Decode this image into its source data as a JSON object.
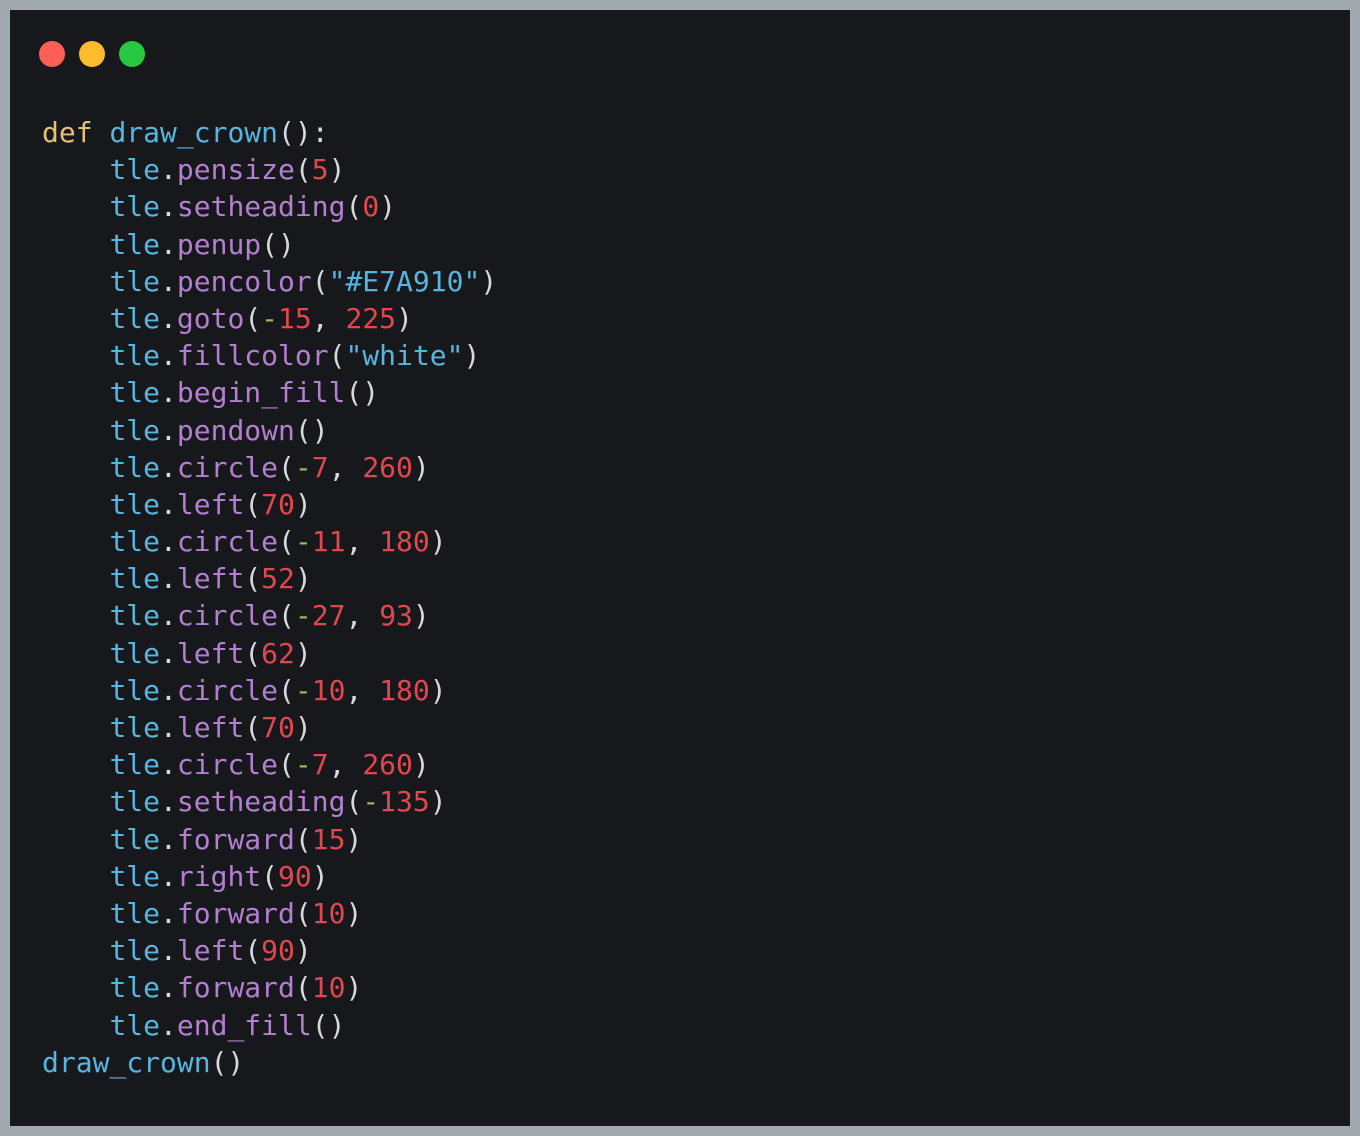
{
  "window": {
    "controls": [
      {
        "name": "close-dot",
        "color": "#ff5f57"
      },
      {
        "name": "minimize-dot",
        "color": "#febc2e"
      },
      {
        "name": "maximize-dot",
        "color": "#28c840"
      }
    ]
  },
  "colors": {
    "background": "#17181b",
    "frame": "#a1a8ae",
    "keyword": "#e5c07b",
    "function": "#56b6e0",
    "method": "#b37fd0",
    "number": "#e0474f",
    "operator": "#9ab95a",
    "string": "#56b6e0",
    "punctuation": "#d7d9dd"
  },
  "code": {
    "language": "python",
    "lines": [
      [
        [
          "kw",
          "def"
        ],
        [
          "ws",
          " "
        ],
        [
          "fn",
          "draw_crown"
        ],
        [
          "punc",
          "():"
        ]
      ],
      [
        [
          "ws",
          "    "
        ],
        [
          "obj",
          "tle"
        ],
        [
          "punc",
          "."
        ],
        [
          "method",
          "pensize"
        ],
        [
          "punc",
          "("
        ],
        [
          "num",
          "5"
        ],
        [
          "punc",
          ")"
        ]
      ],
      [
        [
          "ws",
          "    "
        ],
        [
          "obj",
          "tle"
        ],
        [
          "punc",
          "."
        ],
        [
          "method",
          "setheading"
        ],
        [
          "punc",
          "("
        ],
        [
          "num",
          "0"
        ],
        [
          "punc",
          ")"
        ]
      ],
      [
        [
          "ws",
          "    "
        ],
        [
          "obj",
          "tle"
        ],
        [
          "punc",
          "."
        ],
        [
          "method",
          "penup"
        ],
        [
          "punc",
          "()"
        ]
      ],
      [
        [
          "ws",
          "    "
        ],
        [
          "obj",
          "tle"
        ],
        [
          "punc",
          "."
        ],
        [
          "method",
          "pencolor"
        ],
        [
          "punc",
          "("
        ],
        [
          "str",
          "\"#E7A910\""
        ],
        [
          "punc",
          ")"
        ]
      ],
      [
        [
          "ws",
          "    "
        ],
        [
          "obj",
          "tle"
        ],
        [
          "punc",
          "."
        ],
        [
          "method",
          "goto"
        ],
        [
          "punc",
          "("
        ],
        [
          "op",
          "-"
        ],
        [
          "num",
          "15"
        ],
        [
          "punc",
          ", "
        ],
        [
          "num",
          "225"
        ],
        [
          "punc",
          ")"
        ]
      ],
      [
        [
          "ws",
          "    "
        ],
        [
          "obj",
          "tle"
        ],
        [
          "punc",
          "."
        ],
        [
          "method",
          "fillcolor"
        ],
        [
          "punc",
          "("
        ],
        [
          "str",
          "\"white\""
        ],
        [
          "punc",
          ")"
        ]
      ],
      [
        [
          "ws",
          "    "
        ],
        [
          "obj",
          "tle"
        ],
        [
          "punc",
          "."
        ],
        [
          "method",
          "begin_fill"
        ],
        [
          "punc",
          "()"
        ]
      ],
      [
        [
          "ws",
          "    "
        ],
        [
          "obj",
          "tle"
        ],
        [
          "punc",
          "."
        ],
        [
          "method",
          "pendown"
        ],
        [
          "punc",
          "()"
        ]
      ],
      [
        [
          "ws",
          "    "
        ],
        [
          "obj",
          "tle"
        ],
        [
          "punc",
          "."
        ],
        [
          "method",
          "circle"
        ],
        [
          "punc",
          "("
        ],
        [
          "op",
          "-"
        ],
        [
          "num",
          "7"
        ],
        [
          "punc",
          ", "
        ],
        [
          "num",
          "260"
        ],
        [
          "punc",
          ")"
        ]
      ],
      [
        [
          "ws",
          "    "
        ],
        [
          "obj",
          "tle"
        ],
        [
          "punc",
          "."
        ],
        [
          "method",
          "left"
        ],
        [
          "punc",
          "("
        ],
        [
          "num",
          "70"
        ],
        [
          "punc",
          ")"
        ]
      ],
      [
        [
          "ws",
          "    "
        ],
        [
          "obj",
          "tle"
        ],
        [
          "punc",
          "."
        ],
        [
          "method",
          "circle"
        ],
        [
          "punc",
          "("
        ],
        [
          "op",
          "-"
        ],
        [
          "num",
          "11"
        ],
        [
          "punc",
          ", "
        ],
        [
          "num",
          "180"
        ],
        [
          "punc",
          ")"
        ]
      ],
      [
        [
          "ws",
          "    "
        ],
        [
          "obj",
          "tle"
        ],
        [
          "punc",
          "."
        ],
        [
          "method",
          "left"
        ],
        [
          "punc",
          "("
        ],
        [
          "num",
          "52"
        ],
        [
          "punc",
          ")"
        ]
      ],
      [
        [
          "ws",
          "    "
        ],
        [
          "obj",
          "tle"
        ],
        [
          "punc",
          "."
        ],
        [
          "method",
          "circle"
        ],
        [
          "punc",
          "("
        ],
        [
          "op",
          "-"
        ],
        [
          "num",
          "27"
        ],
        [
          "punc",
          ", "
        ],
        [
          "num",
          "93"
        ],
        [
          "punc",
          ")"
        ]
      ],
      [
        [
          "ws",
          "    "
        ],
        [
          "obj",
          "tle"
        ],
        [
          "punc",
          "."
        ],
        [
          "method",
          "left"
        ],
        [
          "punc",
          "("
        ],
        [
          "num",
          "62"
        ],
        [
          "punc",
          ")"
        ]
      ],
      [
        [
          "ws",
          "    "
        ],
        [
          "obj",
          "tle"
        ],
        [
          "punc",
          "."
        ],
        [
          "method",
          "circle"
        ],
        [
          "punc",
          "("
        ],
        [
          "op",
          "-"
        ],
        [
          "num",
          "10"
        ],
        [
          "punc",
          ", "
        ],
        [
          "num",
          "180"
        ],
        [
          "punc",
          ")"
        ]
      ],
      [
        [
          "ws",
          "    "
        ],
        [
          "obj",
          "tle"
        ],
        [
          "punc",
          "."
        ],
        [
          "method",
          "left"
        ],
        [
          "punc",
          "("
        ],
        [
          "num",
          "70"
        ],
        [
          "punc",
          ")"
        ]
      ],
      [
        [
          "ws",
          "    "
        ],
        [
          "obj",
          "tle"
        ],
        [
          "punc",
          "."
        ],
        [
          "method",
          "circle"
        ],
        [
          "punc",
          "("
        ],
        [
          "op",
          "-"
        ],
        [
          "num",
          "7"
        ],
        [
          "punc",
          ", "
        ],
        [
          "num",
          "260"
        ],
        [
          "punc",
          ")"
        ]
      ],
      [
        [
          "ws",
          "    "
        ],
        [
          "obj",
          "tle"
        ],
        [
          "punc",
          "."
        ],
        [
          "method",
          "setheading"
        ],
        [
          "punc",
          "("
        ],
        [
          "op",
          "-"
        ],
        [
          "num",
          "135"
        ],
        [
          "punc",
          ")"
        ]
      ],
      [
        [
          "ws",
          "    "
        ],
        [
          "obj",
          "tle"
        ],
        [
          "punc",
          "."
        ],
        [
          "method",
          "forward"
        ],
        [
          "punc",
          "("
        ],
        [
          "num",
          "15"
        ],
        [
          "punc",
          ")"
        ]
      ],
      [
        [
          "ws",
          "    "
        ],
        [
          "obj",
          "tle"
        ],
        [
          "punc",
          "."
        ],
        [
          "method",
          "right"
        ],
        [
          "punc",
          "("
        ],
        [
          "num",
          "90"
        ],
        [
          "punc",
          ")"
        ]
      ],
      [
        [
          "ws",
          "    "
        ],
        [
          "obj",
          "tle"
        ],
        [
          "punc",
          "."
        ],
        [
          "method",
          "forward"
        ],
        [
          "punc",
          "("
        ],
        [
          "num",
          "10"
        ],
        [
          "punc",
          ")"
        ]
      ],
      [
        [
          "ws",
          "    "
        ],
        [
          "obj",
          "tle"
        ],
        [
          "punc",
          "."
        ],
        [
          "method",
          "left"
        ],
        [
          "punc",
          "("
        ],
        [
          "num",
          "90"
        ],
        [
          "punc",
          ")"
        ]
      ],
      [
        [
          "ws",
          "    "
        ],
        [
          "obj",
          "tle"
        ],
        [
          "punc",
          "."
        ],
        [
          "method",
          "forward"
        ],
        [
          "punc",
          "("
        ],
        [
          "num",
          "10"
        ],
        [
          "punc",
          ")"
        ]
      ],
      [
        [
          "ws",
          "    "
        ],
        [
          "obj",
          "tle"
        ],
        [
          "punc",
          "."
        ],
        [
          "method",
          "end_fill"
        ],
        [
          "punc",
          "()"
        ]
      ],
      [
        [
          "fn",
          "draw_crown"
        ],
        [
          "punc",
          "()"
        ]
      ]
    ]
  }
}
